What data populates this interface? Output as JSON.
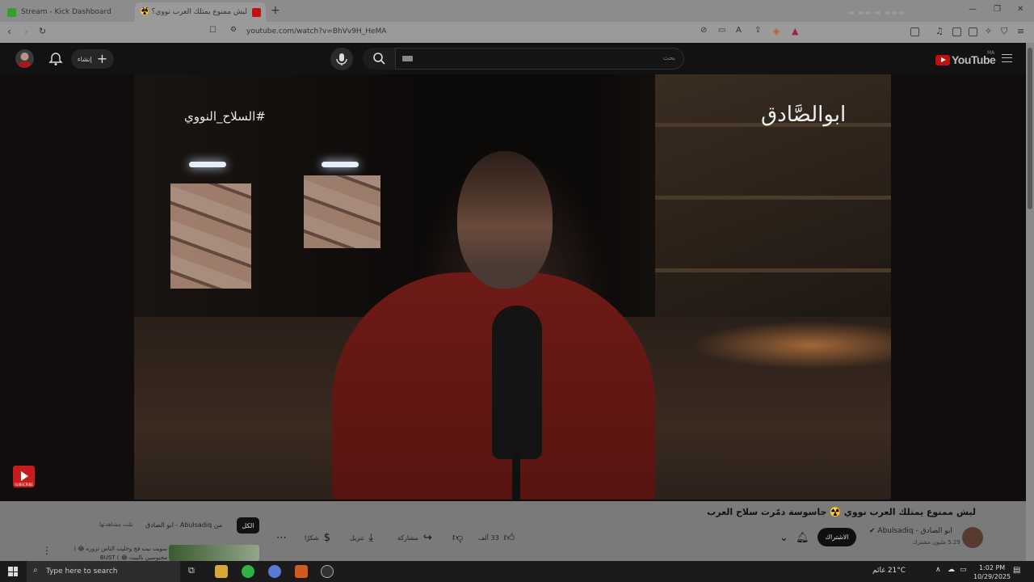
{
  "browser": {
    "tabs": [
      {
        "title": "Stream - Kick Dashboard",
        "favicon": "kick-icon",
        "active": false
      },
      {
        "title": "ليش ممنوع يمتلك العرب نووي؟ ☢️",
        "favicon": "youtube-icon",
        "active": true
      }
    ],
    "url": "youtube.com/watch?v=BhVv9H_HeMA"
  },
  "youtube": {
    "logo_text": "YouTube",
    "country_code": "MA",
    "search_placeholder": "بحث",
    "create_label": "إنشاء"
  },
  "video": {
    "overlay_hashtag": "#السلاح_النووي",
    "overlay_channel": "ابوالصَّادق",
    "title": "ليش ممنوع يمتلك العرب نووي ☢️ جاسوسة دمّرت سلاح العرب",
    "channel_name": "ابو الصادق - Abulsadiq",
    "subscribers": "5.29 مليون مشترك",
    "subscribe_label": "الاشتراك",
    "likes": "33 ألف",
    "share_label": "مشاركة",
    "download_label": "تنزيل",
    "thanks_label": "شكرًا",
    "chip_all": "الكل",
    "chip_from": "من Abulsadiq - ابو الصادق",
    "chip_watched": "تمّت مشاهدتها",
    "related_title": "سويت بيت فخ وخليت الناس تزوره 😂 ( محبوسين بالبيت 😂 ) BUST"
  },
  "taskbar": {
    "search_placeholder": "Type here to search",
    "weather": "21°C غائم",
    "time": "1:02 PM",
    "date": "10/29/2025"
  },
  "colors": {
    "youtube_red": "#c01010",
    "header_bg": "#121212",
    "dimmed_bg": "#7a7a7a"
  }
}
